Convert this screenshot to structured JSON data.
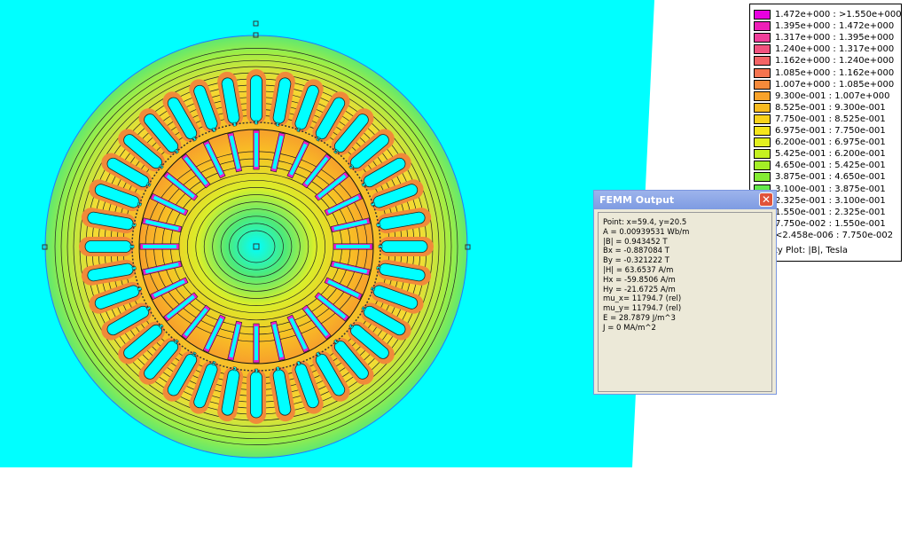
{
  "window": {
    "dialog_title": "FEMM Output",
    "close_glyph": "✕"
  },
  "femm_output": {
    "lines": [
      "Point: x=59.4, y=20.5",
      "A   = 0.00939531 Wb/m",
      "|B| = 0.943452 T",
      "Bx  = -0.887084 T",
      "By  = -0.321222 T",
      "|H| = 63.6537 A/m",
      "Hx  = -59.8506 A/m",
      "Hy  = -21.6725 A/m",
      "mu_x= 11794.7 (rel)",
      "mu_y= 11794.7 (rel)",
      "E   = 28.7879 J/m^3",
      "J   = 0 MA/m^2"
    ]
  },
  "legend": {
    "caption": "ty Plot: |B|, Tesla",
    "entries": [
      {
        "label": "1.472e+000 : >1.550e+000",
        "color": "#e800e0"
      },
      {
        "label": "1.395e+000 : 1.472e+000",
        "color": "#ee1fb8"
      },
      {
        "label": "1.317e+000 : 1.395e+000",
        "color": "#f03f9a"
      },
      {
        "label": "1.240e+000 : 1.317e+000",
        "color": "#f2527f"
      },
      {
        "label": "1.162e+000 : 1.240e+000",
        "color": "#f46466"
      },
      {
        "label": "1.085e+000 : 1.162e+000",
        "color": "#f6744f"
      },
      {
        "label": "1.007e+000 : 1.085e+000",
        "color": "#f78a3a"
      },
      {
        "label": "9.300e-001 : 1.007e+000",
        "color": "#f8a22a"
      },
      {
        "label": "8.525e-001 : 9.300e-001",
        "color": "#f8bb1f"
      },
      {
        "label": "7.750e-001 : 8.525e-001",
        "color": "#f9d21a"
      },
      {
        "label": "6.975e-001 : 7.750e-001",
        "color": "#f5e51c"
      },
      {
        "label": "6.200e-001 : 6.975e-001",
        "color": "#e2f01e"
      },
      {
        "label": "5.425e-001 : 6.200e-001",
        "color": "#c5f120"
      },
      {
        "label": "4.650e-001 : 5.425e-001",
        "color": "#a4ef26"
      },
      {
        "label": "3.875e-001 : 4.650e-001",
        "color": "#84ec33"
      },
      {
        "label": "3.100e-001 : 3.875e-001",
        "color": "#63ea4a"
      },
      {
        "label": "2.325e-001 : 3.100e-001",
        "color": "#3fe96a"
      },
      {
        "label": "1.550e-001 : 2.325e-001",
        "color": "#27e898"
      },
      {
        "label": "7.750e-002 : 1.550e-001",
        "color": "#14eac8"
      },
      {
        "label": "<2.458e-006 : 7.750e-002",
        "color": "#00ffff"
      }
    ]
  },
  "plot": {
    "background_color": "#00ffff",
    "stator_slots": 36,
    "rotor_slots": 28
  }
}
